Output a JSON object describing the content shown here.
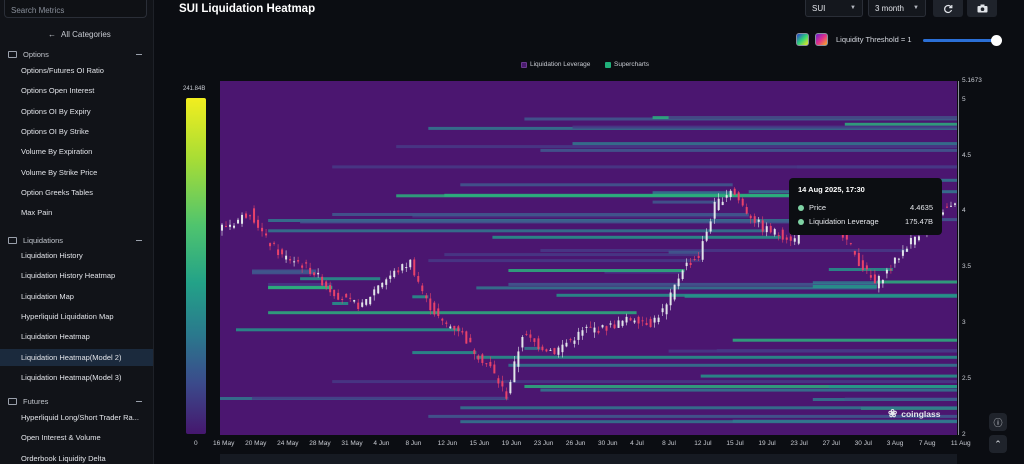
{
  "sidebar": {
    "search_placeholder": "Search Metrics",
    "all_categories": "All Categories",
    "sections": [
      {
        "title": "Options",
        "items": [
          "Options/Futures OI Ratio",
          "Options Open Interest",
          "Options OI By Expiry",
          "Options OI By Strike",
          "Volume By Expiration",
          "Volume By Strike Price",
          "Option Greeks Tables",
          "Max Pain"
        ]
      },
      {
        "title": "Liquidations",
        "items": [
          "Liquidation History",
          "Liquidation History Heatmap",
          "Liquidation Map",
          "Hyperliquid Liquidation Map",
          "Liquidation Heatmap",
          "Liquidation Heatmap(Model 2)",
          "Liquidation Heatmap(Model 3)"
        ]
      },
      {
        "title": "Futures",
        "items": [
          "Hyperliquid Long/Short Trader Ra...",
          "Open Interest & Volume",
          "Orderbook Liquidity Delta"
        ]
      }
    ],
    "active_item": "Liquidation Heatmap(Model 2)"
  },
  "header": {
    "title": "SUI Liquidation Heatmap",
    "symbol": "SUI",
    "range": "3 month",
    "threshold_label": "Liquidity Threshold = 1"
  },
  "legend": [
    "Liquidation Leverage",
    "Supercharts"
  ],
  "colors": {
    "leverage": "#4a1a6e",
    "supercharts": "#20b07a",
    "accent": "#2b6fd6"
  },
  "icons": [
    "refresh-icon",
    "camera-icon",
    "info-icon",
    "chevron-up-icon",
    "arrow-left-icon"
  ],
  "chart_data": {
    "type": "heatmap",
    "title": "SUI Liquidation Heatmap",
    "colorbar": {
      "max_label": "241.84B",
      "min_label": "0"
    },
    "y_ticks": [
      "5.1673",
      "5",
      "4.5",
      "4",
      "3.5",
      "3",
      "2.5",
      "2"
    ],
    "ylim": [
      2,
      5.1673
    ],
    "x_ticks": [
      "16 May",
      "20 May",
      "24 May",
      "28 May",
      "31 May",
      "4 Jun",
      "8 Jun",
      "12 Jun",
      "15 Jun",
      "19 Jun",
      "23 Jun",
      "26 Jun",
      "30 Jun",
      "4 Jul",
      "8 Jul",
      "12 Jul",
      "15 Jul",
      "19 Jul",
      "23 Jul",
      "27 Jul",
      "30 Jul",
      "3 Aug",
      "7 Aug",
      "11 Aug"
    ],
    "price_path": [
      3.85,
      3.9,
      4.0,
      3.75,
      3.6,
      3.55,
      3.45,
      3.3,
      3.2,
      3.15,
      3.35,
      3.45,
      3.55,
      3.2,
      3.0,
      2.95,
      2.75,
      2.6,
      2.35,
      2.9,
      2.8,
      2.75,
      2.85,
      2.95,
      2.95,
      3.0,
      3.05,
      3.0,
      3.15,
      3.5,
      3.6,
      4.05,
      4.2,
      4.0,
      3.85,
      3.8,
      3.75,
      3.95,
      4.1,
      3.8,
      3.55,
      3.35,
      3.5,
      3.7,
      3.85,
      4.0,
      4.05
    ],
    "tooltip": {
      "date": "14 Aug 2025, 17:30",
      "price_label": "Price",
      "price": "4.4635",
      "leverage_label": "Liquidation Leverage",
      "leverage": "175.47B"
    },
    "watermark": "coinglass"
  }
}
